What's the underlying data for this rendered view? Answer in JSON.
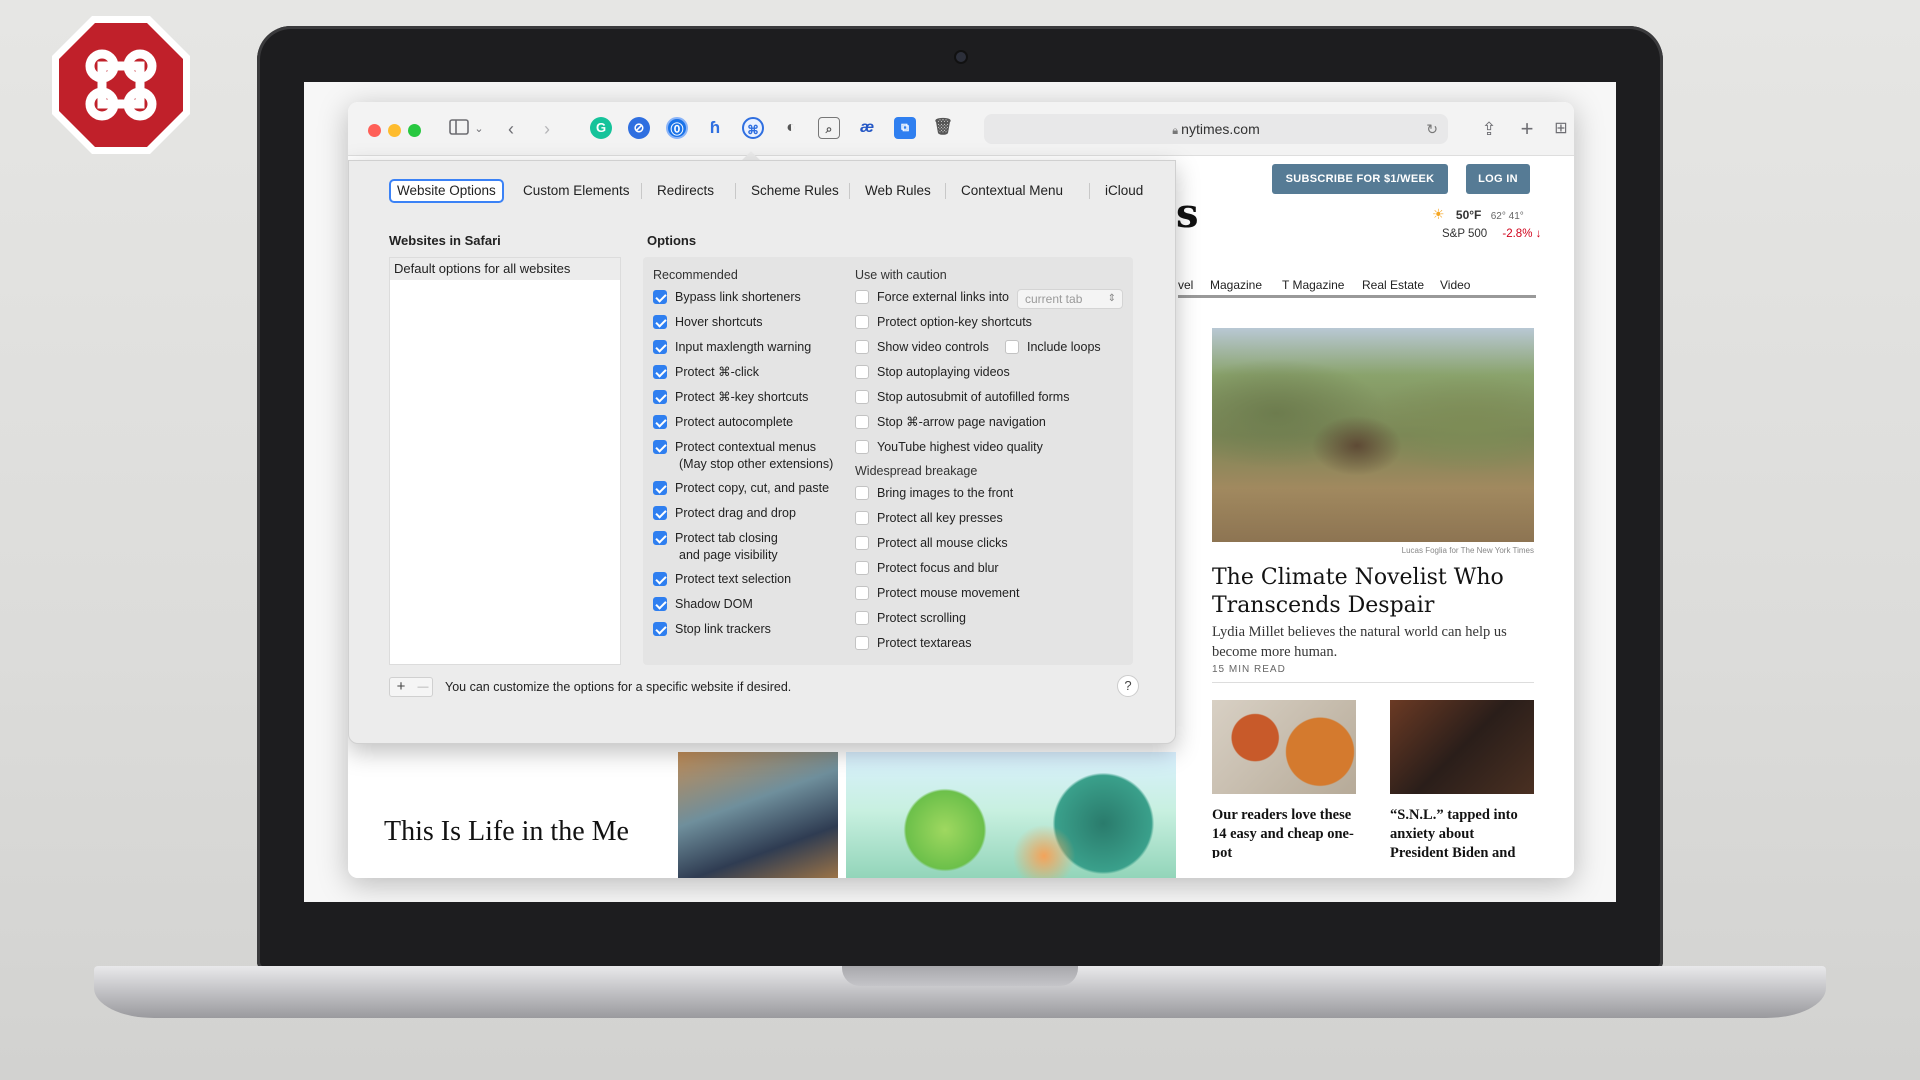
{
  "safari": {
    "address": "nytimes.com",
    "traffic_colors": [
      "#ff5f57",
      "#febc2e",
      "#28c840"
    ]
  },
  "toolbar_icons": [
    "sidebar-icon",
    "chevron-down-icon",
    "back-icon",
    "forward-icon",
    "grammarly-icon",
    "compass-icon",
    "onepassword-icon",
    "keyboard-shortcut-icon",
    "stopthemadness-icon",
    "shield-icon",
    "search-icon",
    "ae-icon",
    "translate-icon",
    "trash-icon"
  ],
  "popover": {
    "tabs": [
      "Website Options",
      "Custom Elements",
      "Redirects",
      "Scheme Rules",
      "Web Rules",
      "Contextual Menu",
      "iCloud"
    ],
    "selected_tab": "Website Options",
    "websites_label": "Websites in Safari",
    "websites": [
      "Default options for all websites"
    ],
    "options_label": "Options",
    "recommended_label": "Recommended",
    "recommended": [
      {
        "label": "Bypass link shorteners",
        "checked": true
      },
      {
        "label": "Hover shortcuts",
        "checked": true
      },
      {
        "label": "Input maxlength warning",
        "checked": true
      },
      {
        "label": "Protect ⌘-click",
        "checked": true
      },
      {
        "label": "Protect ⌘-key shortcuts",
        "checked": true
      },
      {
        "label": "Protect autocomplete",
        "checked": true
      },
      {
        "label": "Protect contextual menus",
        "sub": "(May stop other extensions)",
        "checked": true
      },
      {
        "label": "Protect copy, cut, and paste",
        "checked": true
      },
      {
        "label": "Protect drag and drop",
        "checked": true
      },
      {
        "label": "Protect tab closing",
        "sub": "and page visibility",
        "checked": true
      },
      {
        "label": "Protect text selection",
        "checked": true
      },
      {
        "label": "Shadow DOM",
        "checked": true
      },
      {
        "label": "Stop link trackers",
        "checked": true
      }
    ],
    "caution_label": "Use with caution",
    "caution": [
      {
        "label": "Force external links into",
        "checked": false
      },
      {
        "label": "Protect option-key shortcuts",
        "checked": false
      },
      {
        "label": "Show video controls",
        "checked": false
      },
      {
        "label": "Stop autoplaying videos",
        "checked": false
      },
      {
        "label": "Stop autosubmit of autofilled forms",
        "checked": false
      },
      {
        "label": "Stop ⌘-arrow page navigation",
        "checked": false
      },
      {
        "label": "YouTube highest video quality",
        "checked": false
      }
    ],
    "include_loops": {
      "label": "Include loops",
      "checked": false
    },
    "external_links_select": "current tab",
    "breakage_label": "Widespread breakage",
    "breakage": [
      {
        "label": "Bring images to the front",
        "checked": false
      },
      {
        "label": "Protect all key presses",
        "checked": false
      },
      {
        "label": "Protect all mouse clicks",
        "checked": false
      },
      {
        "label": "Protect focus and blur",
        "checked": false
      },
      {
        "label": "Protect mouse movement",
        "checked": false
      },
      {
        "label": "Protect scrolling",
        "checked": false
      },
      {
        "label": "Protect textareas",
        "checked": false
      }
    ],
    "add_label": "+",
    "remove_label": "—",
    "footer_text": "You can customize the options for a specific website if desired.",
    "help_label": "?"
  },
  "nyt": {
    "subscribe_label": "SUBSCRIBE FOR $1/WEEK",
    "login_label": "LOG IN",
    "temp": "50°F",
    "hilo": "62° 41°",
    "index_name": "S&P 500",
    "index_change": "-2.8% ↓",
    "masthead_fragment": "s",
    "nav": [
      "vel",
      "Magazine",
      "T Magazine",
      "Real Estate",
      "Video"
    ],
    "photo_credit": "Lucas Foglia for The New York Times",
    "headline": "The Climate Novelist Who Transcends Despair",
    "summary": "Lydia Millet believes the natural world can help us become more human.",
    "read_time": "15 MIN READ",
    "card1": "Our readers love these 14 easy and cheap one-pot",
    "card2": "“S.N.L.” tapped into anxiety about President Biden and",
    "bottom_headline": "This Is Life in the Me",
    "accent_color": "#567b95",
    "down_color": "#d0021b"
  }
}
